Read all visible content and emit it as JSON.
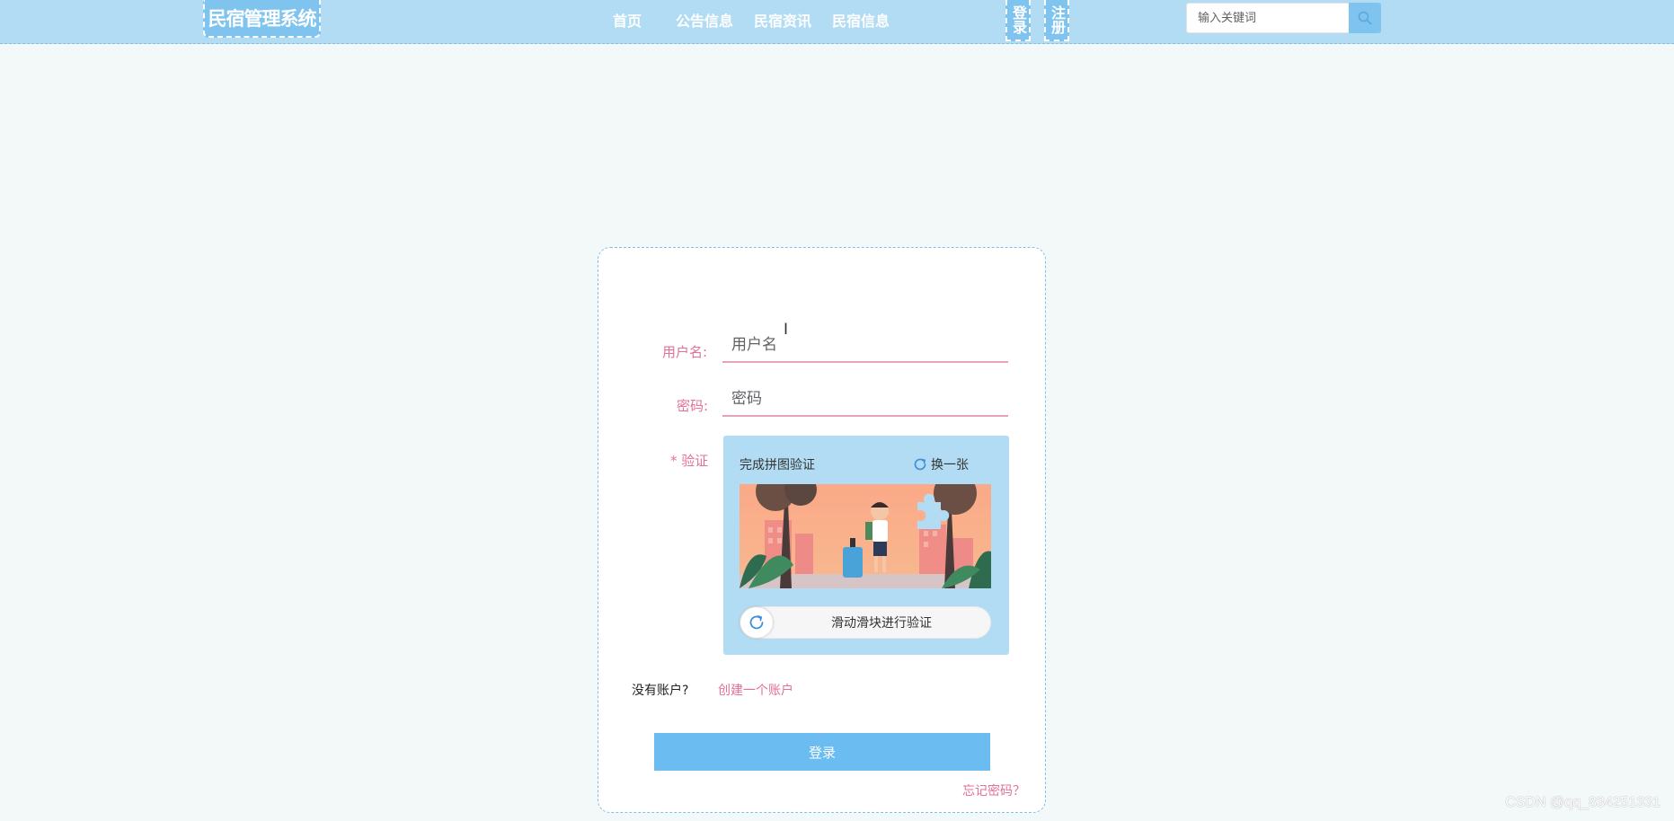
{
  "header": {
    "logo": "民宿管理系统",
    "nav": [
      "首页",
      "公告信息",
      "民宿资讯",
      "民宿信息"
    ],
    "login_btn": "登录",
    "register_btn": "注册",
    "search_placeholder": "输入关键词",
    "search_icon": "search-icon"
  },
  "form": {
    "username_label": "用户名:",
    "username_placeholder": "用户名",
    "password_label": "密码:",
    "password_placeholder": "密码",
    "captcha_label": "* 验证",
    "captcha": {
      "title": "完成拼图验证",
      "refresh_label": "换一张",
      "refresh_icon": "refresh-icon",
      "slider_text": "滑动滑块进行验证",
      "slider_progress": 0
    },
    "no_account_text": "没有账户?",
    "create_account_link": "创建一个账户",
    "submit_label": "登录",
    "forgot_link": "忘记密码？"
  },
  "watermark": "CSDN @qq_834251331",
  "colors": {
    "header_bg": "#b2dcf3",
    "accent": "#7fc3ef",
    "button": "#6bbcf0",
    "pink": "#e3709a",
    "page_bg": "#f3f8f9"
  }
}
